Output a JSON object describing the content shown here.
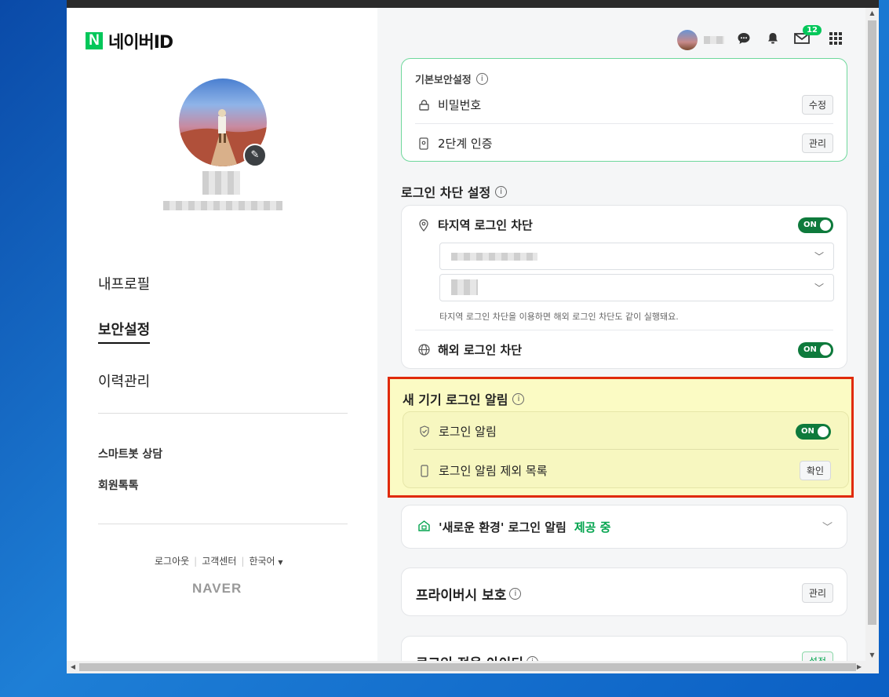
{
  "brand": {
    "logo_letter": "N",
    "title": "네이버ID"
  },
  "nav": {
    "items": [
      {
        "label": "내프로필",
        "active": false
      },
      {
        "label": "보안설정",
        "active": true
      },
      {
        "label": "이력관리",
        "active": false
      }
    ],
    "secondary": [
      {
        "label": "스마트봇 상담"
      },
      {
        "label": "회원톡톡"
      }
    ],
    "footer": {
      "logout": "로그아웃",
      "support": "고객센터",
      "language": "한국어",
      "brand": "NAVER"
    }
  },
  "header": {
    "mail_badge": "12"
  },
  "basic_security": {
    "title": "기본보안설정",
    "password_label": "비밀번호",
    "password_button": "수정",
    "twofactor_label": "2단계 인증",
    "twofactor_button": "관리"
  },
  "login_block": {
    "title": "로그인 차단 설정",
    "region_label": "타지역 로그인 차단",
    "region_toggle": "ON",
    "region_help": "타지역 로그인 차단을 이용하면 해외 로그인 차단도 같이 실행돼요.",
    "overseas_label": "해외 로그인 차단",
    "overseas_toggle": "ON"
  },
  "new_device": {
    "title": "새 기기 로그인 알림",
    "alert_label": "로그인 알림",
    "alert_toggle": "ON",
    "exclude_label": "로그인 알림 제외 목록",
    "exclude_button": "확인"
  },
  "new_env": {
    "label": "'새로운 환경' 로그인 알림",
    "status": "제공 중"
  },
  "privacy": {
    "label": "프라이버시 보호",
    "button": "관리"
  },
  "login_only": {
    "label": "로그인 전용 아이디",
    "button": "설정"
  },
  "colors": {
    "naver_green": "#03c75a",
    "toggle_green": "#0e7a3c",
    "highlight_border": "#e02a0a",
    "highlight_bg": "#fbfbc4"
  },
  "icons": [
    "lock-icon",
    "phone-key-icon",
    "location-pin-icon",
    "globe-icon",
    "shield-check-icon",
    "mobile-icon",
    "home-lock-icon",
    "chat-icon",
    "bell-icon",
    "mail-icon",
    "apps-grid-icon",
    "pencil-icon",
    "chevron-down-icon",
    "info-icon"
  ]
}
